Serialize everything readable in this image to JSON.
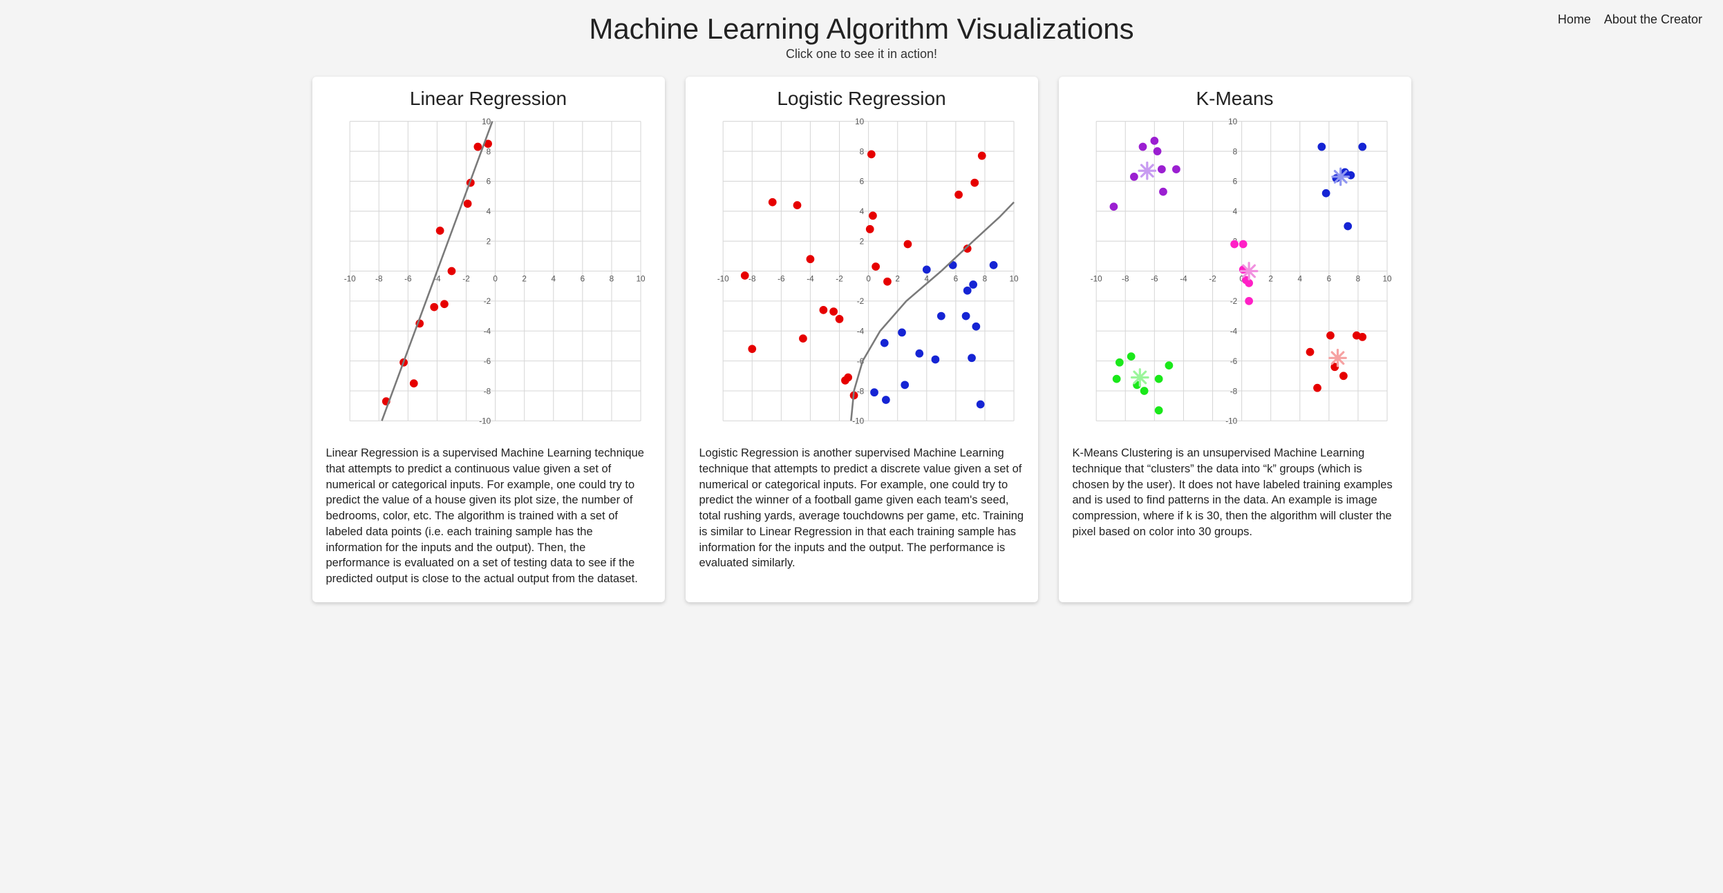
{
  "header": {
    "title": "Machine Learning Algorithm Visualizations",
    "subtitle": "Click one to see it in action!",
    "nav": {
      "home": "Home",
      "about": "About the Creator"
    }
  },
  "cards": {
    "linreg": {
      "title": "Linear Regression",
      "desc": "Linear Regression is a supervised Machine Learning technique that attempts to predict a continuous value given a set of numerical or categorical inputs. For example, one could try to predict the value of a house given its plot size, the number of bedrooms, color, etc. The algorithm is trained with a set of labeled data points (i.e. each training sample has the information for the inputs and the output). Then, the performance is evaluated on a set of testing data to see if the predicted output is close to the actual output from the dataset."
    },
    "logreg": {
      "title": "Logistic Regression",
      "desc": "Logistic Regression is another supervised Machine Learning technique that attempts to predict a discrete value given a set of numerical or categorical inputs. For example, one could try to predict the winner of a football game given each team's seed, total rushing yards, average touchdowns per game, etc. Training is similar to Linear Regression in that each training sample has information for the inputs and the output. The performance is evaluated similarly."
    },
    "kmeans": {
      "title": "K-Means",
      "desc": "K-Means Clustering is an unsupervised Machine Learning technique that “clusters” the data into “k” groups (which is chosen by the user). It does not have labeled training examples and is used to find patterns in the data. An example is image compression, where if k is 30, then the algorithm will cluster the pixel based on color into 30 groups."
    }
  },
  "chart_data": [
    {
      "id": "linreg",
      "type": "scatter",
      "title": "Linear Regression",
      "xlabel": "",
      "ylabel": "",
      "xlim": [
        -10,
        10
      ],
      "ylim": [
        -10,
        10
      ],
      "x_ticks": [
        -10,
        -8,
        -6,
        -4,
        -2,
        0,
        2,
        4,
        6,
        8,
        10
      ],
      "y_ticks": [
        -10,
        -8,
        -6,
        -4,
        -2,
        0,
        2,
        4,
        6,
        8,
        10
      ],
      "series": [
        {
          "name": "points",
          "kind": "points",
          "color": "#e60000",
          "values": [
            [
              -7.5,
              -8.7
            ],
            [
              -6.3,
              -6.1
            ],
            [
              -5.6,
              -7.5
            ],
            [
              -5.2,
              -3.5
            ],
            [
              -4.2,
              -2.4
            ],
            [
              -3.5,
              -2.2
            ],
            [
              -3.0,
              0.0
            ],
            [
              -3.8,
              2.7
            ],
            [
              -1.9,
              4.5
            ],
            [
              -1.7,
              5.9
            ],
            [
              -1.2,
              8.3
            ],
            [
              -0.5,
              8.5
            ]
          ]
        },
        {
          "name": "fit",
          "kind": "line",
          "color": "#7a7a7a",
          "values": [
            [
              -7.8,
              -10.0
            ],
            [
              -0.2,
              10.0
            ]
          ]
        }
      ]
    },
    {
      "id": "logreg",
      "type": "scatter",
      "title": "Logistic Regression",
      "xlabel": "",
      "ylabel": "",
      "xlim": [
        -10,
        10
      ],
      "ylim": [
        -10,
        10
      ],
      "x_ticks": [
        -10,
        -8,
        -6,
        -4,
        -2,
        0,
        2,
        4,
        6,
        8,
        10
      ],
      "y_ticks": [
        -10,
        -8,
        -6,
        -4,
        -2,
        0,
        2,
        4,
        6,
        8,
        10
      ],
      "series": [
        {
          "name": "class-0",
          "kind": "points",
          "color": "#e60000",
          "values": [
            [
              -8.5,
              -0.3
            ],
            [
              -8.0,
              -5.2
            ],
            [
              -6.6,
              4.6
            ],
            [
              -4.9,
              4.4
            ],
            [
              -4.5,
              -4.5
            ],
            [
              -4.0,
              0.8
            ],
            [
              -3.1,
              -2.6
            ],
            [
              -2.4,
              -2.7
            ],
            [
              -2.0,
              -3.2
            ],
            [
              -1.6,
              -7.3
            ],
            [
              -1.4,
              -7.1
            ],
            [
              -1.0,
              -8.3
            ],
            [
              0.2,
              7.8
            ],
            [
              0.3,
              3.7
            ],
            [
              0.1,
              2.8
            ],
            [
              0.5,
              0.3
            ],
            [
              1.3,
              -0.7
            ],
            [
              2.7,
              1.8
            ],
            [
              6.2,
              5.1
            ],
            [
              6.8,
              1.5
            ],
            [
              7.3,
              5.9
            ],
            [
              7.8,
              7.7
            ]
          ]
        },
        {
          "name": "class-1",
          "kind": "points",
          "color": "#1524d4",
          "values": [
            [
              0.4,
              -8.1
            ],
            [
              1.1,
              -4.8
            ],
            [
              1.2,
              -8.6
            ],
            [
              2.3,
              -4.1
            ],
            [
              2.5,
              -7.6
            ],
            [
              3.5,
              -5.5
            ],
            [
              4.0,
              0.1
            ],
            [
              4.6,
              -5.9
            ],
            [
              5.0,
              -3.0
            ],
            [
              5.8,
              0.4
            ],
            [
              6.7,
              -3.0
            ],
            [
              6.8,
              -1.3
            ],
            [
              7.1,
              -5.8
            ],
            [
              7.2,
              -0.9
            ],
            [
              7.4,
              -3.7
            ],
            [
              7.7,
              -8.9
            ],
            [
              8.6,
              0.4
            ]
          ]
        },
        {
          "name": "boundary",
          "kind": "line",
          "color": "#7a7a7a",
          "values": [
            [
              -1.2,
              -10.0
            ],
            [
              -1.0,
              -8.0
            ],
            [
              -0.4,
              -6.0
            ],
            [
              0.8,
              -4.0
            ],
            [
              2.6,
              -2.0
            ],
            [
              5.0,
              0.0
            ],
            [
              7.2,
              2.0
            ],
            [
              9.0,
              3.6
            ],
            [
              10.0,
              4.6
            ]
          ]
        }
      ]
    },
    {
      "id": "kmeans",
      "type": "scatter",
      "title": "K-Means",
      "xlabel": "",
      "ylabel": "",
      "xlim": [
        -10,
        10
      ],
      "ylim": [
        -10,
        10
      ],
      "x_ticks": [
        -10,
        -8,
        -6,
        -4,
        -2,
        0,
        2,
        4,
        6,
        8,
        10
      ],
      "y_ticks": [
        -10,
        -8,
        -6,
        -4,
        -2,
        0,
        2,
        4,
        6,
        8,
        10
      ],
      "series": [
        {
          "name": "cluster-purple",
          "kind": "points",
          "color": "#9b1fd1",
          "values": [
            [
              -8.8,
              4.3
            ],
            [
              -7.4,
              6.3
            ],
            [
              -6.8,
              8.3
            ],
            [
              -6.0,
              8.7
            ],
            [
              -5.8,
              8.0
            ],
            [
              -5.5,
              6.8
            ],
            [
              -5.4,
              5.3
            ],
            [
              -4.5,
              6.8
            ]
          ]
        },
        {
          "name": "cluster-blue",
          "kind": "points",
          "color": "#1524d4",
          "values": [
            [
              5.5,
              8.3
            ],
            [
              5.8,
              5.2
            ],
            [
              6.5,
              6.2
            ],
            [
              7.1,
              6.6
            ],
            [
              7.3,
              3.0
            ],
            [
              7.5,
              6.4
            ],
            [
              8.3,
              8.3
            ]
          ]
        },
        {
          "name": "cluster-magenta",
          "kind": "points",
          "color": "#ff20c6",
          "values": [
            [
              -0.5,
              1.8
            ],
            [
              0.1,
              1.8
            ],
            [
              0.1,
              0.1
            ],
            [
              0.3,
              -0.6
            ],
            [
              0.5,
              -0.8
            ],
            [
              0.5,
              -2.0
            ]
          ]
        },
        {
          "name": "cluster-green",
          "kind": "points",
          "color": "#1ae81a",
          "values": [
            [
              -8.6,
              -7.2
            ],
            [
              -8.4,
              -6.1
            ],
            [
              -7.6,
              -5.7
            ],
            [
              -7.2,
              -7.6
            ],
            [
              -6.7,
              -8.0
            ],
            [
              -5.7,
              -7.2
            ],
            [
              -5.7,
              -9.3
            ],
            [
              -5.0,
              -6.3
            ]
          ]
        },
        {
          "name": "cluster-red",
          "kind": "points",
          "color": "#e60000",
          "values": [
            [
              4.7,
              -5.4
            ],
            [
              5.2,
              -7.8
            ],
            [
              6.1,
              -4.3
            ],
            [
              6.4,
              -6.4
            ],
            [
              7.0,
              -7.0
            ],
            [
              7.9,
              -4.3
            ],
            [
              8.3,
              -4.4
            ]
          ]
        },
        {
          "name": "centroids",
          "kind": "centroids",
          "values": [
            {
              "x": -6.5,
              "y": 6.7,
              "color": "#c89bf1"
            },
            {
              "x": 6.8,
              "y": 6.3,
              "color": "#8f96f0"
            },
            {
              "x": 0.5,
              "y": 0.0,
              "color": "#f191df"
            },
            {
              "x": -7.0,
              "y": -7.1,
              "color": "#9bf59b"
            },
            {
              "x": 6.6,
              "y": -5.8,
              "color": "#f6a2a2"
            }
          ]
        }
      ]
    }
  ]
}
